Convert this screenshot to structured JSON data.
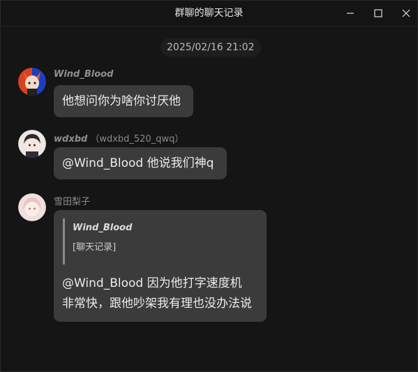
{
  "window": {
    "title": "群聊的聊天记录",
    "controls": {
      "minimize": "minimize-icon",
      "maximize": "maximize-icon",
      "close": "close-icon"
    }
  },
  "timestamp": "2025/02/16 21:02",
  "messages": [
    {
      "sender": {
        "nick": "Wind_Blood",
        "account": ""
      },
      "avatar_icon": "avatar-icon",
      "text": "他想问你为啥你讨厌他"
    },
    {
      "sender": {
        "nick": "wdxbd",
        "account": "（wdxbd_520_qwq）"
      },
      "avatar_icon": "avatar-icon",
      "text": "@Wind_Blood 他说我们神q"
    },
    {
      "sender": {
        "nick": "雪田梨子",
        "account": ""
      },
      "avatar_icon": "avatar-icon",
      "quote": {
        "name": "Wind_Blood",
        "text": "[聊天记录]"
      },
      "lines": [
        "@Wind_Blood 因为他打字速度机",
        "非常快，跟他吵架我有理也没办法说"
      ]
    }
  ],
  "colors": {
    "background": "#151515",
    "bubble": "#3b3b3b",
    "text": "#ececec",
    "muted": "#8d8d8d"
  }
}
